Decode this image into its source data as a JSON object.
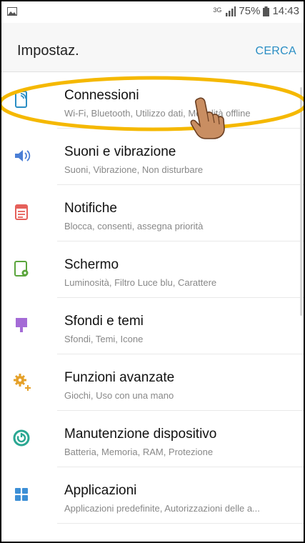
{
  "statusbar": {
    "network": "3G",
    "battery": "75%",
    "time": "14:43",
    "left_icon": "image-icon"
  },
  "header": {
    "title": "Impostaz.",
    "action": "CERCA"
  },
  "accent_color": "#2a8ec4",
  "highlight_color": "#f5b800",
  "items": [
    {
      "title": "Connessioni",
      "subtitle": "Wi-Fi, Bluetooth, Utilizzo dati, Modalità offline",
      "icon": "connections-icon",
      "color": "#2a8ec4"
    },
    {
      "title": "Suoni e vibrazione",
      "subtitle": "Suoni, Vibrazione, Non disturbare",
      "icon": "sound-icon",
      "color": "#4b7fd6"
    },
    {
      "title": "Notifiche",
      "subtitle": "Blocca, consenti, assegna priorità",
      "icon": "notification-icon",
      "color": "#e5605a"
    },
    {
      "title": "Schermo",
      "subtitle": "Luminosità, Filtro Luce blu, Carattere",
      "icon": "display-icon",
      "color": "#5aa53c"
    },
    {
      "title": "Sfondi e temi",
      "subtitle": "Sfondi, Temi, Icone",
      "icon": "wallpaper-icon",
      "color": "#a46bd6"
    },
    {
      "title": "Funzioni avanzate",
      "subtitle": "Giochi, Uso con una mano",
      "icon": "advanced-features-icon",
      "color": "#e5a12a"
    },
    {
      "title": "Manutenzione dispositivo",
      "subtitle": "Batteria, Memoria, RAM, Protezione",
      "icon": "device-maintenance-icon",
      "color": "#2aa792"
    },
    {
      "title": "Applicazioni",
      "subtitle": "Applicazioni predefinite, Autorizzazioni delle a...",
      "icon": "apps-icon",
      "color": "#3d8fd6"
    }
  ]
}
